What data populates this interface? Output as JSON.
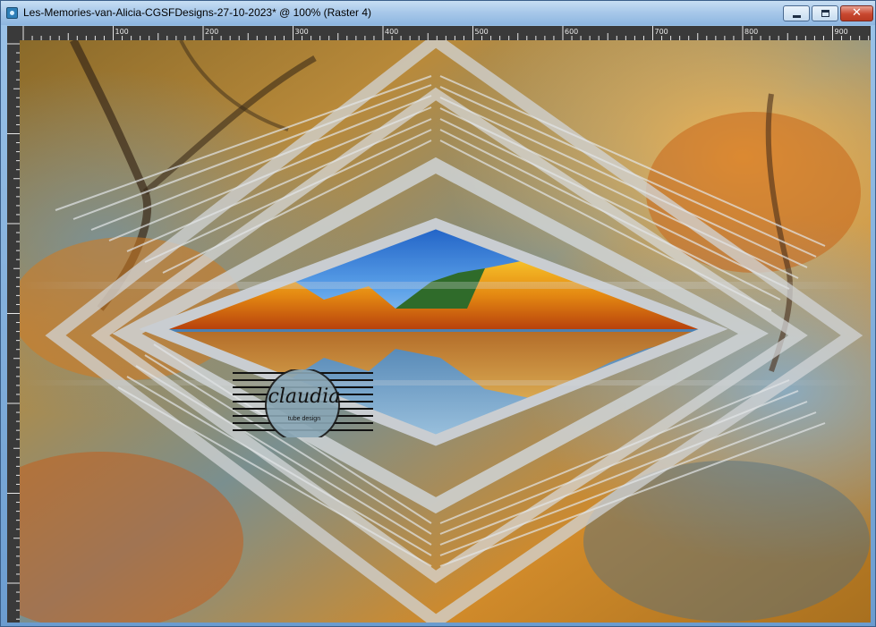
{
  "window": {
    "title": "Les-Memories-van-Alicia-CGSFDesigns-27-10-2023* @ 100% (Raster 4)",
    "controls": {
      "minimize": "minimize",
      "maximize": "maximize",
      "close": "✕"
    }
  },
  "ruler": {
    "horizontal_labels": [
      "100",
      "200",
      "300",
      "400",
      "500",
      "600",
      "700",
      "800",
      "900"
    ]
  },
  "canvas": {
    "watermark_text": "claudia",
    "watermark_subtext": "tube design"
  },
  "colors": {
    "titlebar": "#a9c9ea",
    "ruler_bg": "#3a3a3a",
    "close_button": "#c8472f",
    "frame_silver": "#c9cdd1",
    "autumn_orange": "#e08a1e",
    "sky_blue": "#2f7fd6"
  }
}
